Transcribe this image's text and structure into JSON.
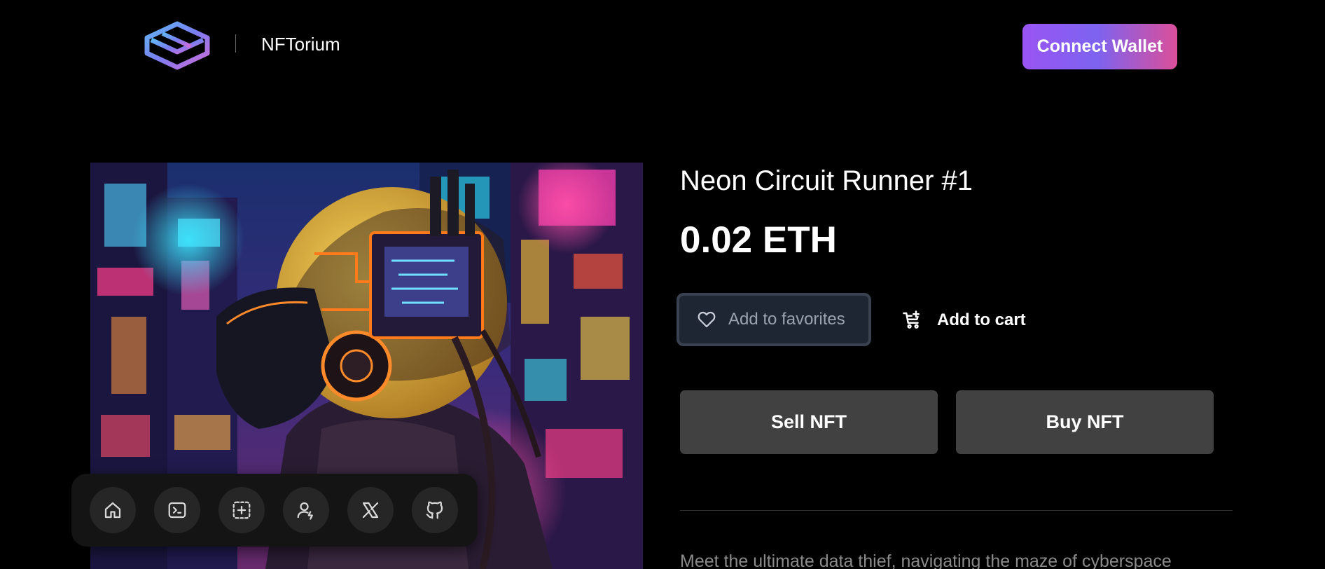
{
  "header": {
    "brand_name": "NFTorium",
    "logo_icon": "layered-hexagon-logo-icon",
    "connect_wallet_label": "Connect Wallet"
  },
  "nft": {
    "title": "Neon Circuit Runner #1",
    "price": "0.02 ETH",
    "image_alt": "Cyberpunk figure wearing a neon-lit helmet against a glowing city backdrop",
    "favorite_label": "Add to favorites",
    "favorite_icon": "heart-icon",
    "cart_label": "Add to cart",
    "cart_icon": "cart-plus-icon",
    "sell_label": "Sell NFT",
    "buy_label": "Buy NFT",
    "description": "Meet the ultimate data thief, navigating the maze of cyberspace"
  },
  "dock": {
    "items": [
      {
        "icon": "home-icon"
      },
      {
        "icon": "terminal-icon"
      },
      {
        "icon": "add-square-icon"
      },
      {
        "icon": "user-plus-icon"
      },
      {
        "icon": "x-logo-icon"
      },
      {
        "icon": "github-icon"
      }
    ]
  },
  "colors": {
    "background": "#000000",
    "connect_gradient_start": "#9a55f3",
    "connect_gradient_end": "#db4f9a",
    "trade_button": "#414141",
    "favorite_button_bg": "#1f2633",
    "dock_bg": "#141414",
    "dock_button_bg": "#262626"
  }
}
